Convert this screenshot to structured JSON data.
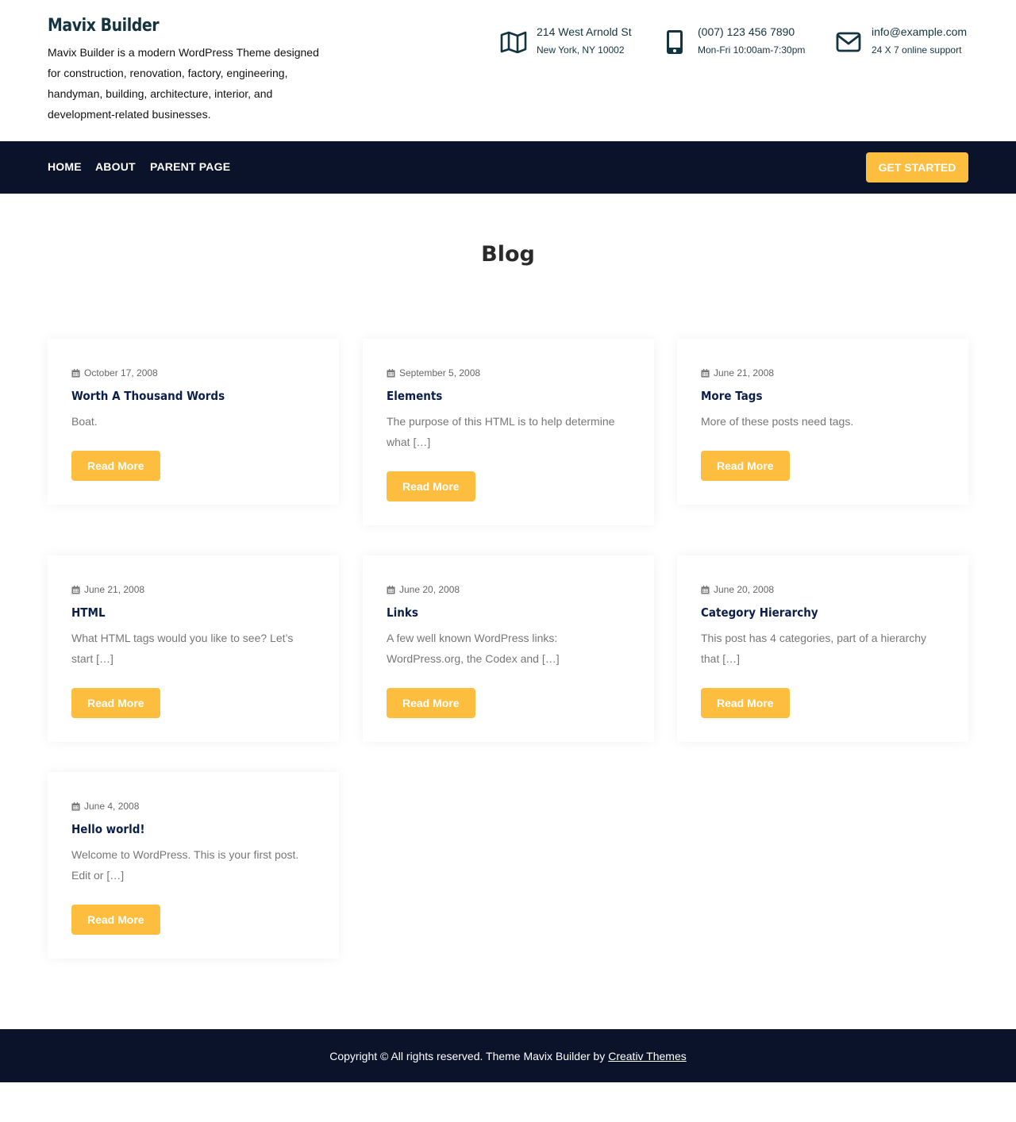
{
  "site": {
    "title": "Mavix Builder",
    "description": "Mavix Builder is a modern WordPress Theme designed for construction, renovation, factory, engineering, handyman, building, architecture, interior, and development-related businesses."
  },
  "contacts": [
    {
      "icon": "map-icon",
      "line1": "214 West Arnold St",
      "line2": "New York, NY 10002"
    },
    {
      "icon": "phone-icon",
      "line1": "(007) 123 456 7890",
      "line2": "Mon-Fri 10:00am-7:30pm"
    },
    {
      "icon": "envelope-icon",
      "line1": "info@example.com",
      "line2": "24 X 7 online support"
    }
  ],
  "nav": {
    "items": [
      "HOME",
      "ABOUT",
      "PARENT PAGE"
    ],
    "cta": "GET STARTED"
  },
  "page": {
    "title": "Blog"
  },
  "posts": [
    {
      "date": "October 17, 2008",
      "title": "Worth A Thousand Words",
      "excerpt": "Boat.",
      "button": "Read More"
    },
    {
      "date": "September 5, 2008",
      "title": "Elements",
      "excerpt": "The purpose of this HTML is to help determine what […]",
      "button": "Read More"
    },
    {
      "date": "June 21, 2008",
      "title": "More Tags",
      "excerpt": "More of these posts need tags.",
      "button": "Read More"
    },
    {
      "date": "June 21, 2008",
      "title": "HTML",
      "excerpt": "What HTML tags would you like to see? Let’s start […]",
      "button": "Read More"
    },
    {
      "date": "June 20, 2008",
      "title": "Links",
      "excerpt": "A few well known WordPress links: WordPress.org, the Codex and […]",
      "button": "Read More"
    },
    {
      "date": "June 20, 2008",
      "title": "Category Hierarchy",
      "excerpt": "This post has 4 categories, part of a hierarchy that […]",
      "button": "Read More"
    },
    {
      "date": "June 4, 2008",
      "title": "Hello world!",
      "excerpt": "Welcome to WordPress. This is your first post. Edit or […]",
      "button": "Read More"
    }
  ],
  "footer": {
    "text": "Copyright © All rights reserved. Theme Mavix Builder by",
    "link": "Creativ Themes"
  },
  "colors": {
    "navy": "#0b132b",
    "accent": "#fdbd3f",
    "heading": "#0b1f4a",
    "muted": "#777777"
  }
}
